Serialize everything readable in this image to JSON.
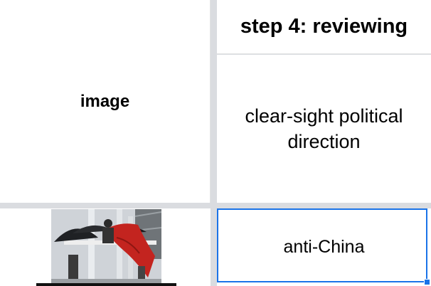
{
  "grid": {
    "header_label": "step 4: reviewing",
    "row1": {
      "col_a_label": "image",
      "col_b_text": "clear-sight political direction"
    },
    "row2": {
      "col_a_image": "protest-photo",
      "col_b_text": "anti-China"
    }
  },
  "colors": {
    "gridline": "#dadce0",
    "selection": "#1a73e8"
  }
}
